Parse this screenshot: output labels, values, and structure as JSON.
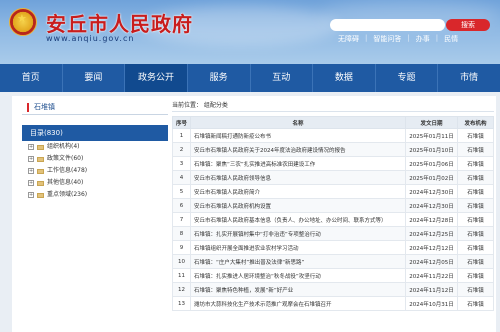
{
  "header": {
    "title": "安丘市人民政府",
    "url": "www.anqiu.gov.cn",
    "search_btn": "搜索",
    "quick_links": [
      "无障碍",
      "智能问答",
      "办事",
      "民情"
    ]
  },
  "nav": [
    "首页",
    "要闻",
    "政务公开",
    "服务",
    "互动",
    "数据",
    "专题",
    "市情"
  ],
  "nav_active": 2,
  "sidebar": {
    "head": "石堆镇",
    "category": "目录(830)",
    "items": [
      "组织机构(4)",
      "政策文件(60)",
      "工作信息(478)",
      "其他信息(40)",
      "重点领域(236)"
    ]
  },
  "main": {
    "crumb": "当前位置： 组配分类",
    "columns": [
      "序号",
      "名称",
      "发文日期",
      "发布机构"
    ],
    "rows": [
      [
        "1",
        "石堆镇新闻稿打通防新疫公布书",
        "2025年01月11日",
        "石堆镇"
      ],
      [
        "2",
        "安丘市石堆镇人民政府关于2024年度法治政府建设情况的报告",
        "2025年01月10日",
        "石堆镇"
      ],
      [
        "3",
        "石堆镇：聚焦“三农”扎实推进高标准农田建设工作",
        "2025年01月06日",
        "石堆镇"
      ],
      [
        "4",
        "安丘市石堆镇人民政府领导信息",
        "2025年01月02日",
        "石堆镇"
      ],
      [
        "5",
        "安丘市石堆镇人民政府简介",
        "2024年12月30日",
        "石堆镇"
      ],
      [
        "6",
        "安丘市石堆镇人民政府机构设置",
        "2024年12月30日",
        "石堆镇"
      ],
      [
        "7",
        "安丘市石堆镇人民政府基本信息（负责人、办公地址、办公时间、联系方式等）",
        "2024年12月28日",
        "石堆镇"
      ],
      [
        "8",
        "石堆镇：扎实开展镇村集中“打非治违”专项整治行动",
        "2024年12月25日",
        "石堆镇"
      ],
      [
        "9",
        "石堆镇组织开展全面推进农业农村学习活动",
        "2024年12月12日",
        "石堆镇"
      ],
      [
        "10",
        "石堆镇：“庄户大集村”推出普及法律“新思路”",
        "2024年12月05日",
        "石堆镇"
      ],
      [
        "11",
        "石堆镇：扎实推进人居环境整治“秋冬战役”攻坚行动",
        "2024年11月22日",
        "石堆镇"
      ],
      [
        "12",
        "石堆镇：聚焦特色种植，发展“新”好产业",
        "2024年11月12日",
        "石堆镇"
      ],
      [
        "13",
        "潍坊市大蒜科技化生产技术示范推广观摩会在石堆镇召开",
        "2024年10月31日",
        "石堆镇"
      ]
    ]
  }
}
